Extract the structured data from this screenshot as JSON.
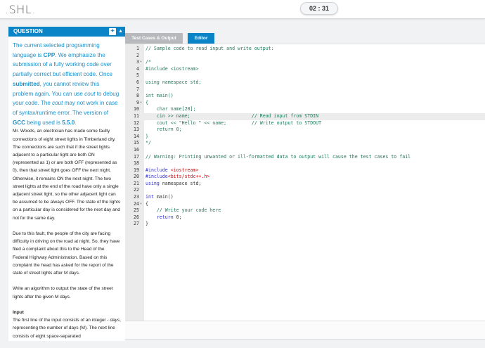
{
  "header": {
    "logo": "SHL",
    "timer": "02 : 31"
  },
  "question": {
    "title": "QUESTION",
    "intro": [
      {
        "t": "The current selected programming language is "
      },
      {
        "b": "CPP"
      },
      {
        "t": ". We emphasize the submission of a fully working code over partially correct but efficient code. Once "
      },
      {
        "b": "submitted"
      },
      {
        "t": ", you cannot review this problem again. You can use "
      },
      {
        "i": "cout"
      },
      {
        "t": " to debug your code.  The "
      },
      {
        "i": "cout"
      },
      {
        "t": " may not work in case of syntax/runtime error. The version of "
      },
      {
        "b": "GCC"
      },
      {
        "t": " being used is "
      },
      {
        "b": "5.5.0"
      },
      {
        "t": "."
      }
    ],
    "paragraphs": [
      "Mr. Woods, an electrician has made some faulty connections of eight street lights in Timberland city. The connections are such that if the street lights adjacent to a particular light are both ON (represented as 1) or are both OFF (represented as 0), then that street light goes OFF the next night. Otherwise, it remains  ON the next night. The two street lights at the end of the road have only a single adjacent street light, so the other adjacent light can be assumed to be always OFF. The state of the lights on a particular day is considered for the next day and not for the same day.",
      "Due to this fault, the people of the city are facing difficulty in driving on the road at night. So, they have filed a complaint about this to the Head of the Federal Highway Administration. Based on this complaint the head has asked for the report of the state of street lights after M days.",
      "Write an algorithm to output the state of the street lights after the given M days."
    ],
    "input_heading": "Input",
    "input_text_a": "The first line of the input consists of an integer - ",
    "input_text_i": "days",
    "input_text_b": ", representing the number of days (M). The next line consists of eight space-separated"
  },
  "tabs": [
    "Test Cases & Output",
    "Editor"
  ],
  "editor": {
    "active_line": 11,
    "lines": [
      [
        {
          "c": "// Sample code to read input and write output:"
        }
      ],
      [],
      [
        {
          "c": "/*"
        }
      ],
      [
        {
          "c": "#include <iostream>"
        }
      ],
      [],
      [
        {
          "c": "using namespace std;"
        }
      ],
      [],
      [
        {
          "c": "int main()"
        }
      ],
      [
        {
          "c": "{"
        }
      ],
      [
        {
          "c": "    char name[20];"
        }
      ],
      [
        {
          "c": "    cin >> name;                      // Read input from STDIN"
        }
      ],
      [
        {
          "c": "    cout << \"Hello \" << name;         // Write output to STDOUT"
        }
      ],
      [
        {
          "c": "    return 0;"
        }
      ],
      [
        {
          "c": "}"
        }
      ],
      [
        {
          "c": "*/"
        }
      ],
      [],
      [
        {
          "c": "// Warning: Printing unwanted or ill-formatted data to output will cause the test cases to fail"
        }
      ],
      [],
      [
        {
          "k": "#include "
        },
        {
          "s": "<iostream>"
        }
      ],
      [
        {
          "k": "#include"
        },
        {
          "s": "<bits/stdc++.h>"
        }
      ],
      [
        {
          "k": "using "
        },
        {
          "p": "namespace std;"
        }
      ],
      [],
      [
        {
          "k": "int "
        },
        {
          "p": "main()"
        }
      ],
      [
        {
          "p": "{"
        }
      ],
      [
        {
          "c": "    // Write your code here"
        }
      ],
      [
        {
          "k": "    return "
        },
        {
          "p": "0;"
        }
      ],
      [
        {
          "p": "}"
        }
      ]
    ],
    "fold_lines": [
      3,
      9,
      24
    ]
  }
}
